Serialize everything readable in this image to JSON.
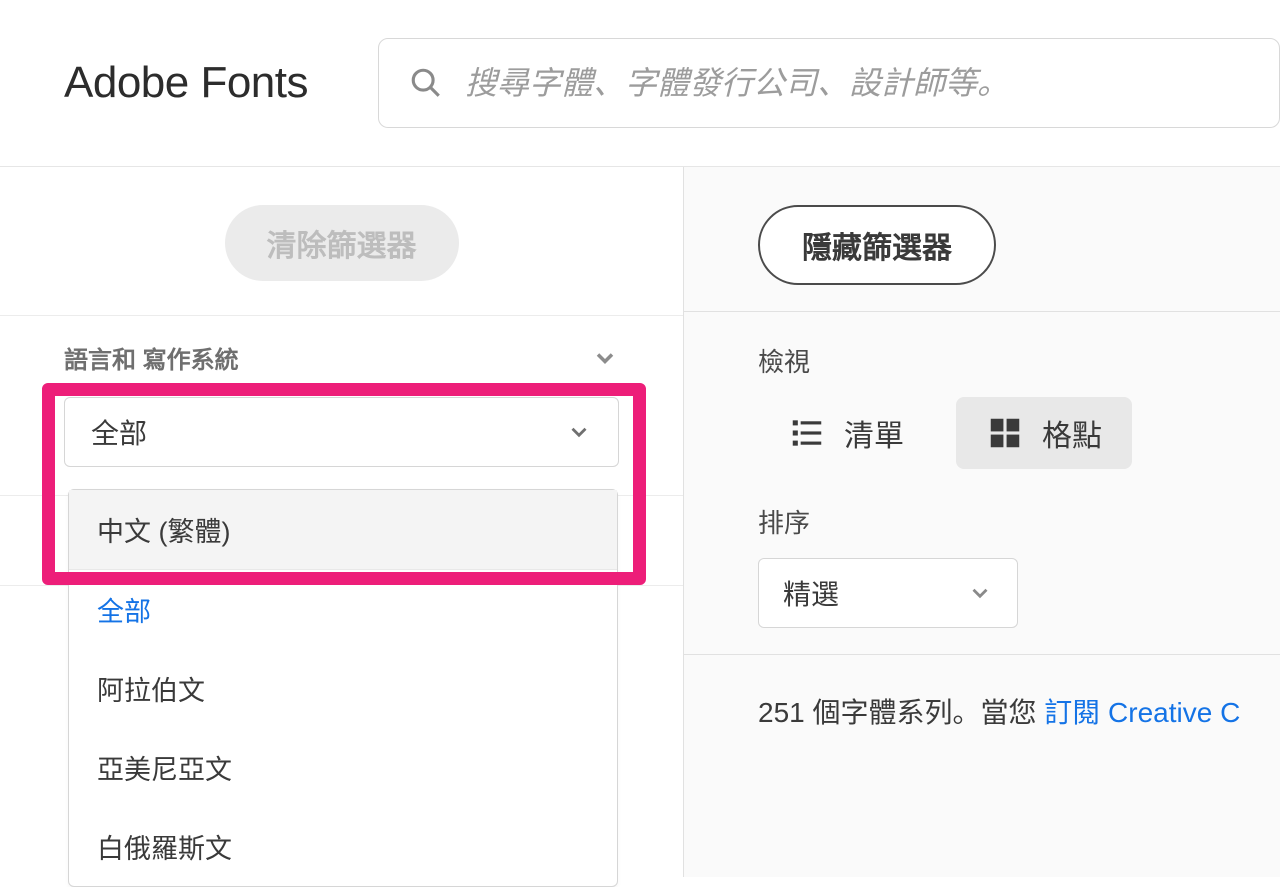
{
  "header": {
    "logo": "Adobe Fonts",
    "search_placeholder": "搜尋字體、字體發行公司、設計師等。"
  },
  "sidebar": {
    "clear_label": "清除篩選器",
    "filter_title": "語言和 寫作系統",
    "select_value": "全部",
    "dropdown_items": [
      {
        "label": "中文 (繁體)",
        "hovered": true
      },
      {
        "label": "全部",
        "selected": true
      },
      {
        "label": "阿拉伯文"
      },
      {
        "label": "亞美尼亞文"
      },
      {
        "label": "白俄羅斯文"
      }
    ]
  },
  "main": {
    "hide_filters_label": "隱藏篩選器",
    "view_label": "檢視",
    "view_list": "清單",
    "view_grid": "格點",
    "sort_label": "排序",
    "sort_value": "精選",
    "results_prefix": "251 個字體系列。當您 ",
    "results_link": "訂閱 Creative C"
  }
}
